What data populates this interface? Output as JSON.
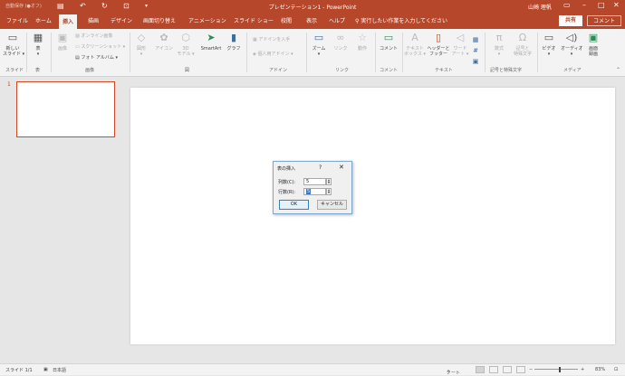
{
  "titlebar": {
    "autosave": "自動保存 (●オフ)",
    "doc_title": "プレゼンテーション1 - PowerPoint",
    "user": "山崎 理帆",
    "icons": [
      "save-icon",
      "undo-icon",
      "redo-icon",
      "present-icon",
      "customize-icon",
      "ribbon-display-icon",
      "minimize-icon",
      "restore-icon",
      "close-icon"
    ]
  },
  "menu": {
    "tabs": [
      "ファイル",
      "ホーム",
      "挿入",
      "描画",
      "デザイン",
      "画面切り替え",
      "アニメーション",
      "スライド ショー",
      "校閲",
      "表示",
      "ヘルプ"
    ],
    "search": "実行したい作業を入力してください",
    "share": "共有",
    "comment": "コメント"
  },
  "ribbon": {
    "new_slide": "新しい\nスライド ▾",
    "table": "表\n▾",
    "picture": "画像",
    "online_picture": "オンライン画像",
    "screenshot": "スクリーンショット ▾",
    "photo_album": "フォト アルバム ▾",
    "shapes": "図形\n▾",
    "icons": "アイコン",
    "models_3d": "3D\nモデル ▾",
    "smartart": "SmartArt",
    "graph": "グラフ",
    "addins": "アドインを入手",
    "my_addins": "個人用アドイン ▾",
    "zoom": "ズーム\n▾",
    "link": "リンク",
    "action": "動作",
    "comment": "コメント",
    "textbox": "テキスト\nボックス ▾",
    "header_footer": "ヘッダーと\nフッター",
    "wordart": "ワード\nアート ▾",
    "equation": "数式\n▾",
    "symbol": "記号と\n特殊文字",
    "video": "ビデオ\n▾",
    "audio": "オーディオ\n▾",
    "screen_record": "画面\n録画",
    "groups": [
      "スライド",
      "表",
      "画像",
      "図",
      "アドイン",
      "リンク",
      "コメント",
      "テキスト",
      "記号と特殊文字",
      "メディア"
    ]
  },
  "thumbnails": {
    "number": "1"
  },
  "dialog": {
    "title": "表の挿入",
    "help": "?",
    "close": "✕",
    "columns_label": "列数(C):",
    "columns_value": "5",
    "rows_label": "行数(R):",
    "rows_value": "5",
    "ok": "OK",
    "cancel": "キャンセル"
  },
  "status": {
    "slide": "スライド 1/1",
    "language": "日本語",
    "notes": "ノート",
    "zoom": "83%"
  }
}
